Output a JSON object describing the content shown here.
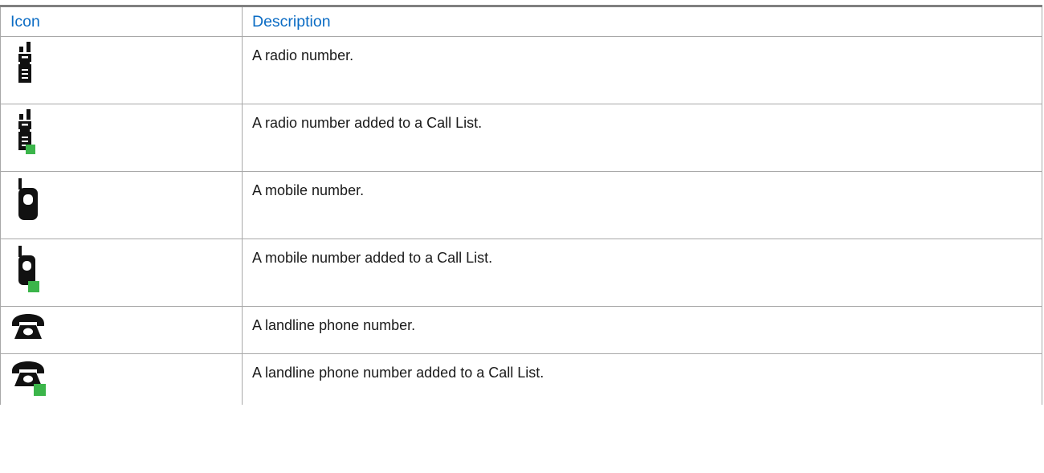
{
  "table": {
    "headers": {
      "icon": "Icon",
      "description": "Description"
    },
    "header_color": "#0b6cc4",
    "badge_color": "#3bb54a",
    "rows": [
      {
        "icon": "radio-icon",
        "has_badge": false,
        "description": "A radio number."
      },
      {
        "icon": "radio-icon",
        "has_badge": true,
        "description": "A radio number added to a Call List."
      },
      {
        "icon": "mobile-phone-icon",
        "has_badge": false,
        "description": "A mobile number."
      },
      {
        "icon": "mobile-phone-icon",
        "has_badge": true,
        "description": "A mobile number added to a Call List."
      },
      {
        "icon": "landline-phone-icon",
        "has_badge": false,
        "description": "A landline phone number."
      },
      {
        "icon": "landline-phone-icon",
        "has_badge": true,
        "description": "A landline phone number added to a Call List."
      }
    ]
  }
}
